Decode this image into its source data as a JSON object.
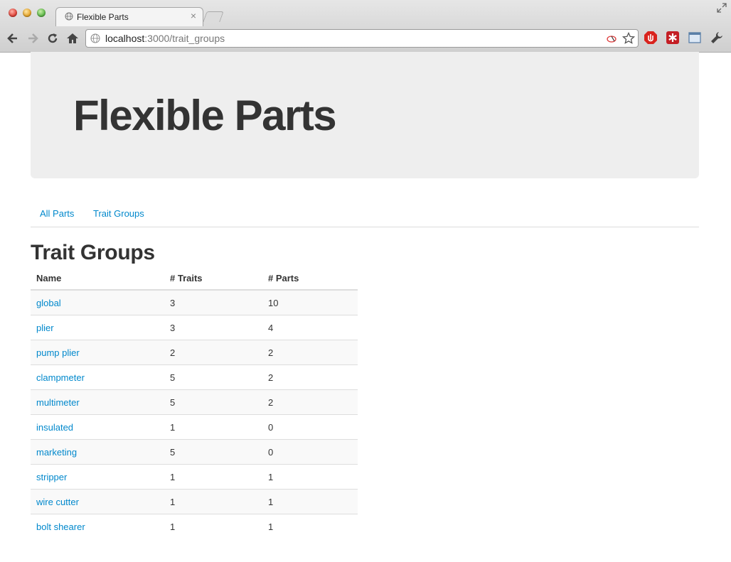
{
  "browser": {
    "tab_title": "Flexible Parts",
    "tab_close": "×",
    "url_host": "localhost",
    "url_rest": ":3000/trait_groups"
  },
  "page": {
    "hero_title": "Flexible Parts",
    "nav": [
      "All Parts",
      "Trait Groups"
    ],
    "section_title": "Trait Groups",
    "table": {
      "headers": [
        "Name",
        "# Traits",
        "# Parts"
      ],
      "rows": [
        {
          "name": "global",
          "traits": "3",
          "parts": "10"
        },
        {
          "name": "plier",
          "traits": "3",
          "parts": "4"
        },
        {
          "name": "pump plier",
          "traits": "2",
          "parts": "2"
        },
        {
          "name": "clampmeter",
          "traits": "5",
          "parts": "2"
        },
        {
          "name": "multimeter",
          "traits": "5",
          "parts": "2"
        },
        {
          "name": "insulated",
          "traits": "1",
          "parts": "0"
        },
        {
          "name": "marketing",
          "traits": "5",
          "parts": "0"
        },
        {
          "name": "stripper",
          "traits": "1",
          "parts": "1"
        },
        {
          "name": "wire cutter",
          "traits": "1",
          "parts": "1"
        },
        {
          "name": "bolt shearer",
          "traits": "1",
          "parts": "1"
        }
      ]
    }
  },
  "colors": {
    "link": "#0088cc",
    "hero_bg": "#eeeeee",
    "text": "#333333"
  }
}
